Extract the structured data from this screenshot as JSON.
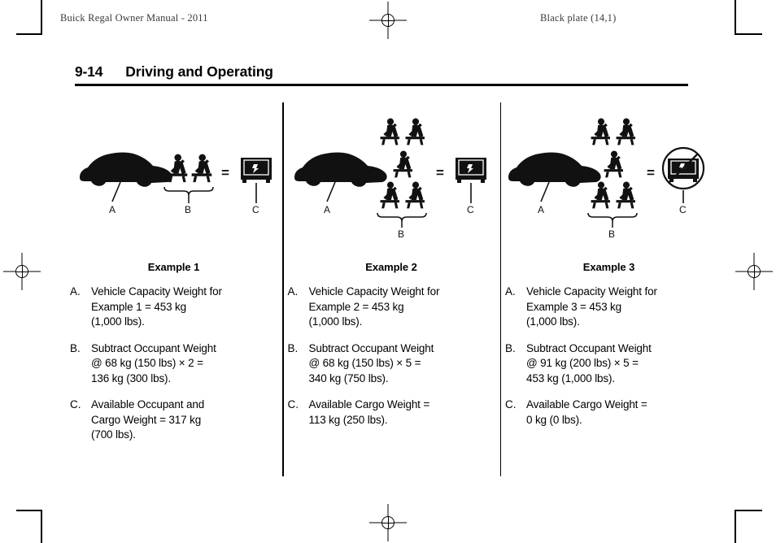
{
  "running_head": {
    "left": "Buick Regal Owner Manual - 2011",
    "right": "Black plate (14,1)"
  },
  "page": {
    "number": "9-14",
    "section_title": "Driving and Operating"
  },
  "columns": [
    {
      "heading": "Example 1",
      "figure": {
        "vehicle_label": "A",
        "occupants_label": "B",
        "cargo_label": "C",
        "minus_sign": "–",
        "equals_sign": "=",
        "occupant_count": 2,
        "occupant_rows": [
          2
        ],
        "cargo_prohibited": false
      },
      "items": [
        {
          "marker": "A.",
          "text": "Vehicle Capacity Weight for\nExample 1 = 453 kg\n(1,000 lbs)."
        },
        {
          "marker": "B.",
          "text": "Subtract Occupant Weight\n@ 68 kg (150 lbs) × 2 =\n136 kg (300 lbs)."
        },
        {
          "marker": "C.",
          "text": "Available Occupant and\nCargo Weight = 317 kg\n(700 lbs)."
        }
      ]
    },
    {
      "heading": "Example 2",
      "figure": {
        "vehicle_label": "A",
        "occupants_label": "B",
        "cargo_label": "C",
        "minus_sign": "–",
        "equals_sign": "=",
        "occupant_count": 5,
        "occupant_rows": [
          2,
          1,
          2
        ],
        "cargo_prohibited": false
      },
      "items": [
        {
          "marker": "A.",
          "text": "Vehicle Capacity Weight for\nExample 2 = 453 kg\n(1,000 lbs)."
        },
        {
          "marker": "B.",
          "text": "Subtract Occupant Weight\n@ 68 kg (150 lbs) × 5 =\n340 kg (750 lbs)."
        },
        {
          "marker": "C.",
          "text": "Available Cargo Weight =\n113 kg (250 lbs)."
        }
      ]
    },
    {
      "heading": "Example 3",
      "figure": {
        "vehicle_label": "A",
        "occupants_label": "B",
        "cargo_label": "C",
        "minus_sign": "–",
        "equals_sign": "=",
        "occupant_count": 5,
        "occupant_rows": [
          2,
          1,
          2
        ],
        "cargo_prohibited": true
      },
      "items": [
        {
          "marker": "A.",
          "text": "Vehicle Capacity Weight for\nExample 3 = 453 kg\n(1,000 lbs)."
        },
        {
          "marker": "B.",
          "text": "Subtract Occupant Weight\n@ 91 kg (200 lbs) × 5 =\n453 kg (1,000 lbs)."
        },
        {
          "marker": "C.",
          "text": "Available Cargo Weight =\n0 kg (0 lbs)."
        }
      ]
    }
  ],
  "colors": {
    "ink": "#000000",
    "paper": "#ffffff",
    "runhead_gray": "#3a3a3a"
  }
}
